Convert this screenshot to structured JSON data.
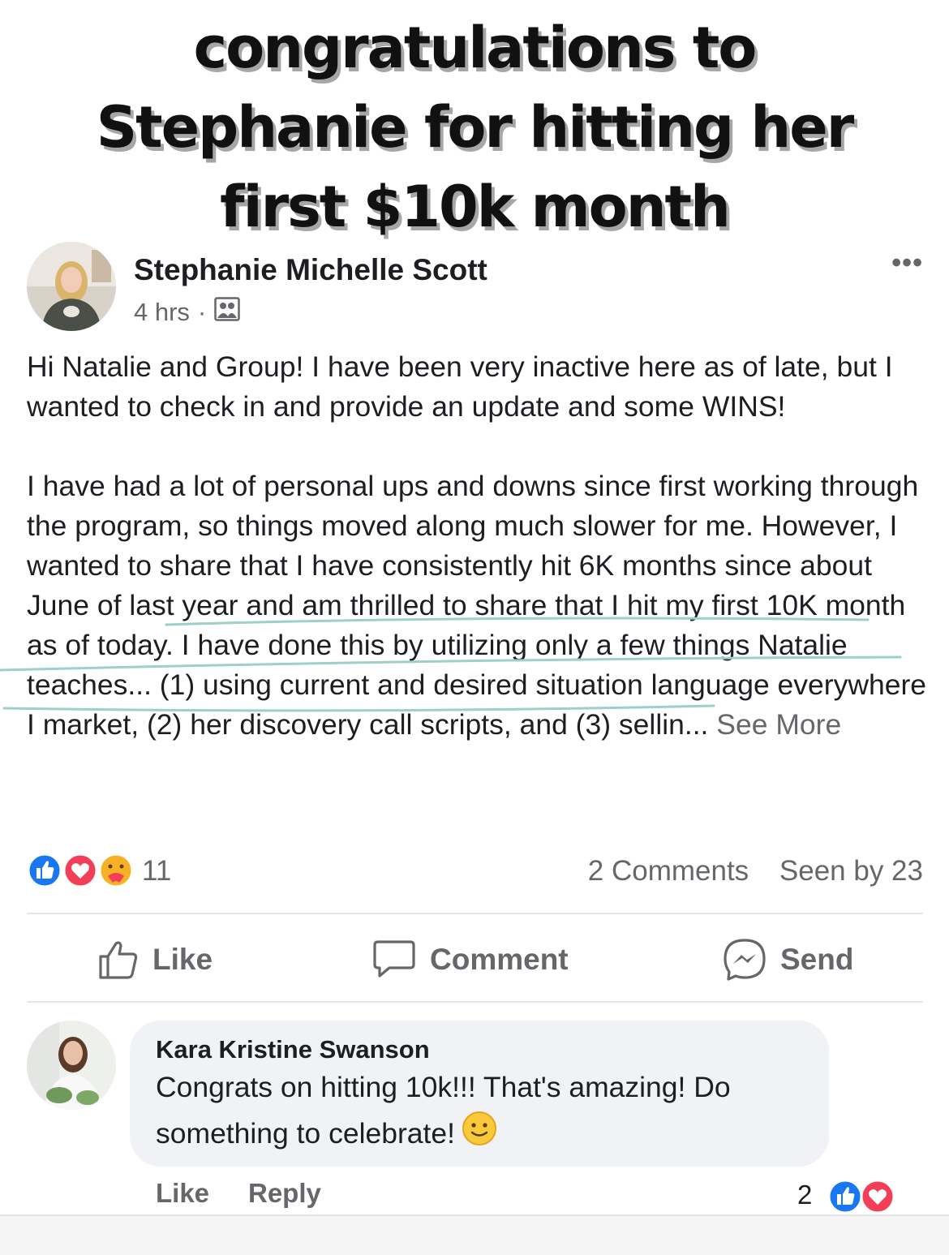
{
  "headline": {
    "line1": "congratulations to",
    "line2": "Stephanie for hitting her",
    "line3": "first $10k month"
  },
  "post": {
    "author": "Stephanie Michelle Scott",
    "time": "4 hrs",
    "separator": "·",
    "audience_icon": "group-icon",
    "menu_icon": "more-dots-icon",
    "menu_glyph": "•••",
    "paragraph1": "Hi Natalie and Group! I have been very inactive here as of late, but I wanted to check in and provide an update and some WINS!",
    "paragraph2": "I have had a lot of personal ups and downs since first working through the program, so things moved along much slower for me. However, I wanted to share that I have consistently hit 6K months since about June of last year and am thrilled to share that I hit my first 10K month as of today. I have done this by utilizing only a few things Natalie teaches... (1) using current and desired situation language everywhere I market, (2) her discovery call scripts, and (3) sellin...",
    "see_more": "See More"
  },
  "reactions": {
    "icons": [
      "like-reaction-icon",
      "love-reaction-icon",
      "care-reaction-icon"
    ],
    "count": "11",
    "comments": "2 Comments",
    "seen_by": "Seen by 23"
  },
  "actions": {
    "like": "Like",
    "comment": "Comment",
    "send": "Send"
  },
  "comment": {
    "author": "Kara Kristine Swanson",
    "text": "Congrats on hitting 10k!!! That's amazing! Do something to celebrate!",
    "emoji": "slightly-smiling-face-icon",
    "like": "Like",
    "reply": "Reply",
    "reaction_count": "2",
    "reaction_icons": [
      "like-reaction-icon",
      "love-reaction-icon"
    ]
  },
  "colors": {
    "text": "#1c1e21",
    "secondary": "#65676b",
    "like_blue": "#1877f2",
    "love_red": "#f33e58",
    "care_yellow": "#f7b125",
    "bubble_bg": "#f0f2f5",
    "highlight_teal": "#9ecfc8"
  }
}
